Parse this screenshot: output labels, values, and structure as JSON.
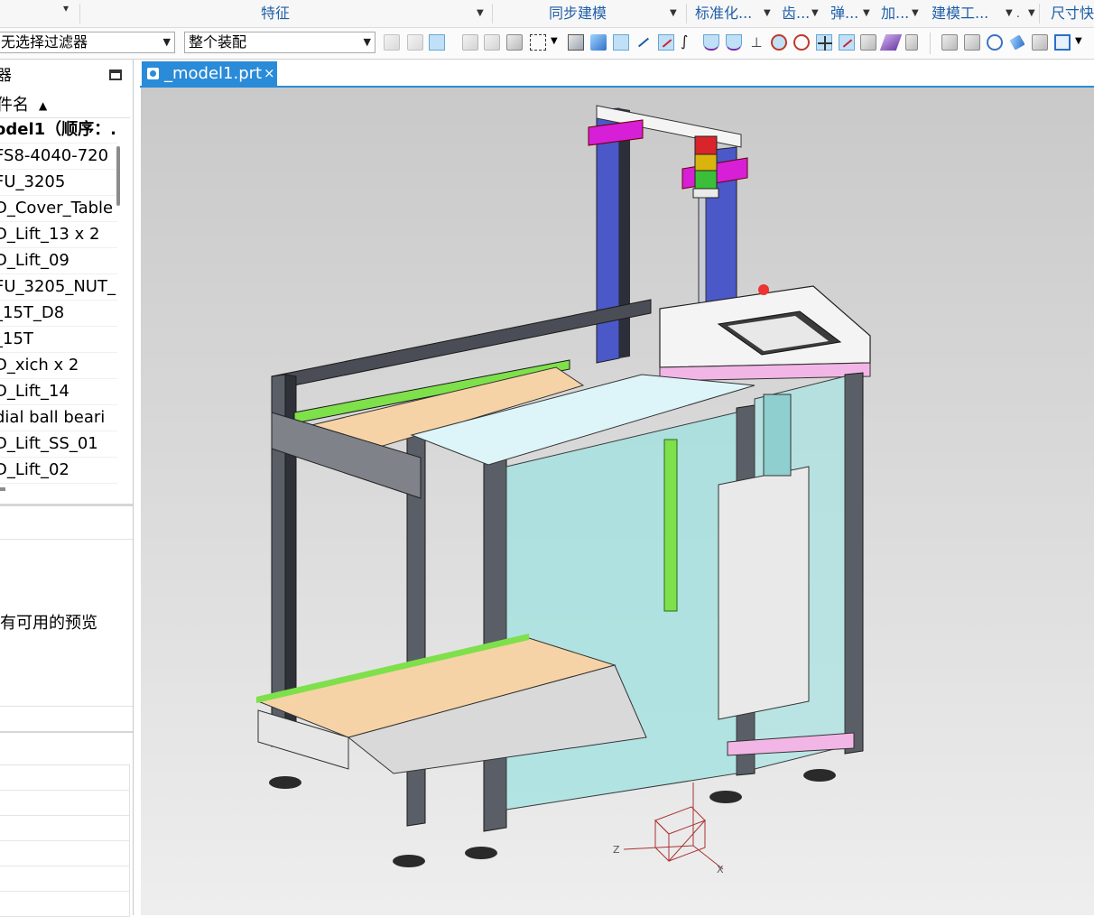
{
  "ribbon": {
    "groups": [
      {
        "label": "特征"
      },
      {
        "label": "同步建模"
      },
      {
        "label": "标准化..."
      },
      {
        "label": "齿..."
      },
      {
        "label": "弹..."
      },
      {
        "label": "加..."
      },
      {
        "label": "建模工..."
      },
      {
        "label": "尺寸快"
      }
    ]
  },
  "toolbar": {
    "filter_value": "无选择过滤器",
    "scope_value": "整个装配"
  },
  "navigator": {
    "title": "器",
    "column_header": "件名",
    "items": [
      {
        "label": "odel1（顺序：.",
        "bold": true
      },
      {
        "label": "FS8-4040-720"
      },
      {
        "label": "FU_3205"
      },
      {
        "label": "D_Cover_Table"
      },
      {
        "label": "D_Lift_13 x 2"
      },
      {
        "label": "D_Lift_09"
      },
      {
        "label": "FU_3205_NUT_"
      },
      {
        "label": "_15T_D8"
      },
      {
        "label": "_15T"
      },
      {
        "label": "D_xich x 2"
      },
      {
        "label": "D_Lift_14"
      },
      {
        "label": "dial ball beari"
      },
      {
        "label": "D_Lift_SS_01"
      },
      {
        "label": "D_Lift_02"
      }
    ],
    "preview_message": "有可用的预览"
  },
  "document": {
    "tab_label": "_model1.prt",
    "close_glyph": "×"
  },
  "viewport": {
    "triad": {
      "z_label": "Z",
      "x_label": "X"
    },
    "colors": {
      "frame": "#4a4d55",
      "panel_glass": "#9fe2e0",
      "belt": "#f6d3a6",
      "rail": "#7ee04a",
      "bracket": "#d61fd6",
      "pink_plate": "#f2b6e6",
      "column_blue": "#4b58c8"
    }
  }
}
